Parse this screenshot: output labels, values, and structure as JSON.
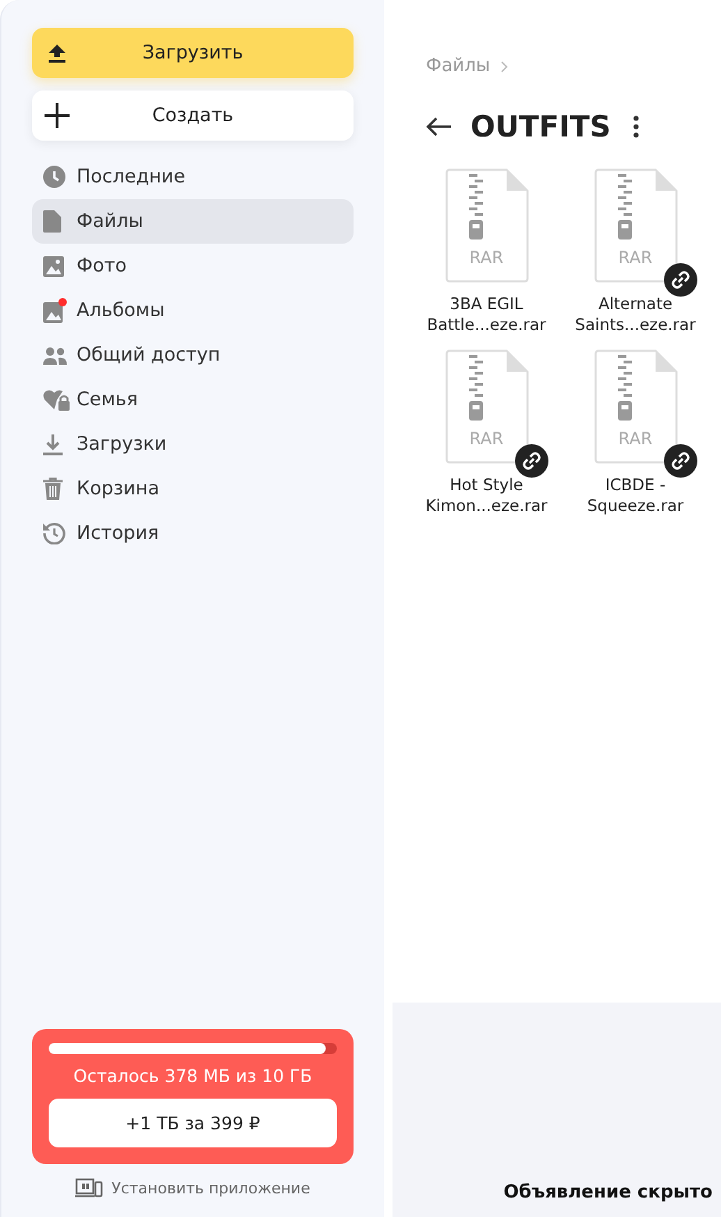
{
  "sidebar": {
    "upload_button": "Загрузить",
    "create_button": "Создать",
    "items": [
      {
        "kind": "recent",
        "label": "Последние",
        "selected": false,
        "badge": false
      },
      {
        "kind": "files",
        "label": "Файлы",
        "selected": true,
        "badge": false
      },
      {
        "kind": "photo",
        "label": "Фото",
        "selected": false,
        "badge": false
      },
      {
        "kind": "albums",
        "label": "Альбомы",
        "selected": false,
        "badge": true
      },
      {
        "kind": "shared",
        "label": "Общий доступ",
        "selected": false,
        "badge": false
      },
      {
        "kind": "family",
        "label": "Семья",
        "selected": false,
        "badge": false
      },
      {
        "kind": "downloads",
        "label": "Загрузки",
        "selected": false,
        "badge": false
      },
      {
        "kind": "trash",
        "label": "Корзина",
        "selected": false,
        "badge": false
      },
      {
        "kind": "history",
        "label": "История",
        "selected": false,
        "badge": false
      }
    ],
    "storage": {
      "level": 0.96,
      "text": "Осталось 378 МБ из 10 ГБ",
      "button": "+1 ТБ за 399 ₽"
    },
    "install_app": "Установить приложение"
  },
  "breadcrumb": [
    "Файлы"
  ],
  "folder_title": "OUTFITS",
  "files": [
    {
      "type": "RAR",
      "name": [
        "3BA EGIL",
        "Battle...eze.rar"
      ],
      "shared": false
    },
    {
      "type": "RAR",
      "name": [
        "Alternate",
        "Saints...eze.rar"
      ],
      "shared": true
    },
    {
      "type": "RAR",
      "name": [
        "Hot Style",
        "Kimon...eze.rar"
      ],
      "shared": true
    },
    {
      "type": "RAR",
      "name": [
        "ICBDE -",
        "Squeeze.rar"
      ],
      "shared": true
    }
  ],
  "ad": {
    "text": "Объявление скрыто"
  }
}
